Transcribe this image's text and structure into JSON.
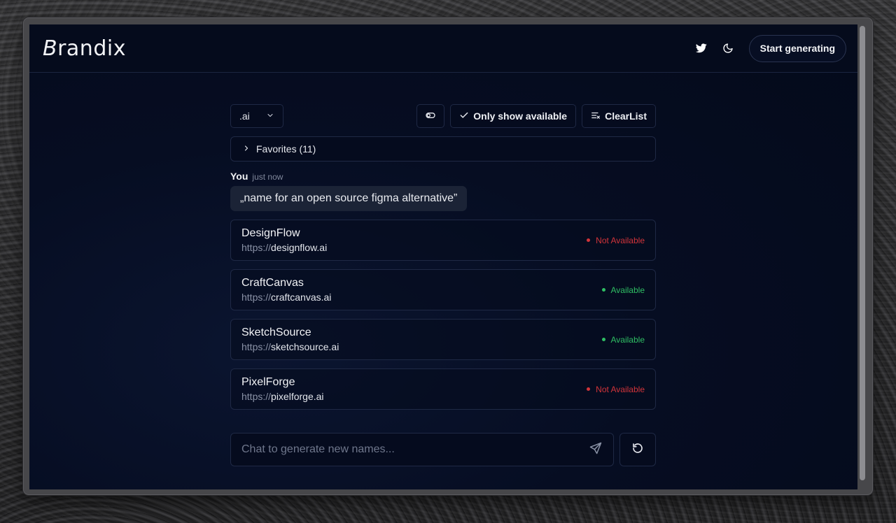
{
  "header": {
    "logo_initial": "B",
    "logo_rest": "randix",
    "twitter_icon": "twitter-icon",
    "theme_icon": "moon-icon",
    "cta_label": "Start generating"
  },
  "toolbar": {
    "tld_value": ".ai",
    "toggle_icon": "toggle-icon",
    "only_available_label": "Only show available",
    "clear_label": "ClearList"
  },
  "favorites": {
    "label": "Favorites (11)"
  },
  "message": {
    "author": "You",
    "time": "just now",
    "text": "„name for an open source figma alternative”"
  },
  "results": [
    {
      "name": "DesignFlow",
      "protocol": "https://",
      "domain": "designflow.ai",
      "status": "Not Available",
      "available": false
    },
    {
      "name": "CraftCanvas",
      "protocol": "https://",
      "domain": "craftcanvas.ai",
      "status": "Available",
      "available": true
    },
    {
      "name": "SketchSource",
      "protocol": "https://",
      "domain": "sketchsource.ai",
      "status": "Available",
      "available": true
    },
    {
      "name": "PixelForge",
      "protocol": "https://",
      "domain": "pixelforge.ai",
      "status": "Not Available",
      "available": false
    }
  ],
  "chat": {
    "placeholder": "Chat to generate new names...",
    "value": ""
  },
  "colors": {
    "available": "#2fbf64",
    "not_available": "#d2343a",
    "background": "#040a1a"
  }
}
